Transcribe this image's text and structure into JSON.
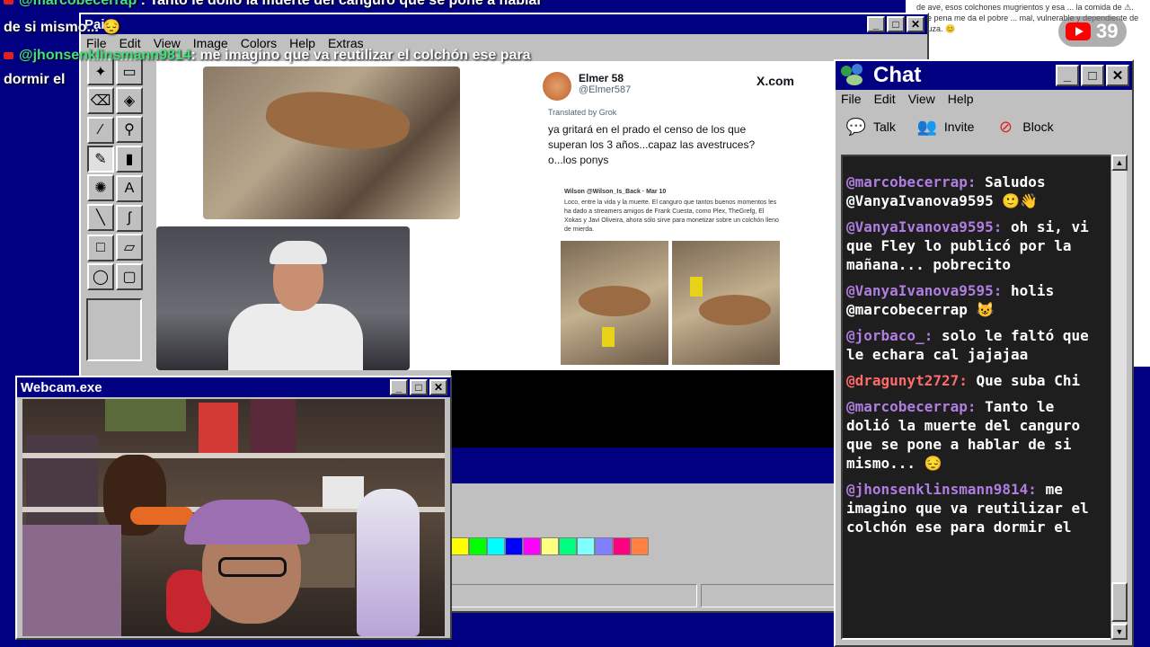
{
  "overlay": {
    "line1_user": "@marcobecerrap",
    "line1_text": "Tanto le dolió la muerte del canguro que se pone a hablar",
    "line2_text": "de si mismo... 😔",
    "line3_user": "@jhonsenklinsmann9814",
    "line3_text": ": me imagino que va reutilizar el colchón ese para",
    "line4_text": "dormir el"
  },
  "youtube_badge": {
    "count": "39"
  },
  "bg_page_text": "de ave, esos colchones mugrientos y esa ... la comida de ⚠. Que pena me da el pobre ... mal, vulnerable y dependiente de ... tuza. 😊",
  "paint": {
    "title": "Paint",
    "menu": [
      "File",
      "Edit",
      "View",
      "Image",
      "Colors",
      "Help",
      "Extras"
    ],
    "tools": [
      "✦",
      "▭",
      "⌫",
      "◈",
      "⁄",
      "⚲",
      "✎",
      "▮",
      "✺",
      "A",
      "╲",
      "∫",
      "□",
      "▱",
      "◯",
      "▢"
    ],
    "palette": [
      "#ffff00",
      "#00ff00",
      "#00ffff",
      "#0000ff",
      "#ff00ff",
      "#ffff80",
      "#00ff80",
      "#80ffff",
      "#8080ff",
      "#ff0080",
      "#ff8040"
    ]
  },
  "tweet": {
    "name": "Elmer 58",
    "handle": "@Elmer587",
    "site": "X.com",
    "translated": "Translated by Grok",
    "text": "ya gritará en el prado el censo de los que superan los 3 años...capaz las avestruces? o...los ponys",
    "quote_head": "Wilson @Wilson_Is_Back · Mar 10",
    "quote_body": "Loco, entre la vida y la muerte. El canguro que tantos buenos momentos les ha dado a streamers amigos de Frank Cuesta, como Plex, TheGrefg, El Xokas y Javi Oliveira, ahora sólo sirve para monetizar sobre un colchón lleno de mierda."
  },
  "webcam": {
    "title": "Webcam.exe"
  },
  "chat": {
    "title": "Chat",
    "menu": [
      "File",
      "Edit",
      "View",
      "Help"
    ],
    "toolbar": {
      "talk": "Talk",
      "invite": "Invite",
      "block": "Block"
    },
    "messages": [
      {
        "user": "@marcobecerrap:",
        "text": "Saludos @VanyaIvanova9595 🙂👋"
      },
      {
        "user": "@VanyaIvanova9595:",
        "text": "oh si, vi que Fley lo publicó por la mañana... pobrecito"
      },
      {
        "user": "@VanyaIvanova9595:",
        "text": "holis @marcobecerrap 😺"
      },
      {
        "user": "@jorbaco_:",
        "text": "solo le faltó que le echara cal jajajaa"
      },
      {
        "user": "@dragunyt2727:",
        "text": "Que suba Chi"
      },
      {
        "user": "@marcobecerrap:",
        "text": "Tanto le dolió la muerte del canguro que se pone a hablar de si mismo... 😔"
      },
      {
        "user": "@jhonsenklinsmann9814:",
        "text": "me imagino que va reutilizar el colchón ese para dormir el"
      }
    ]
  }
}
